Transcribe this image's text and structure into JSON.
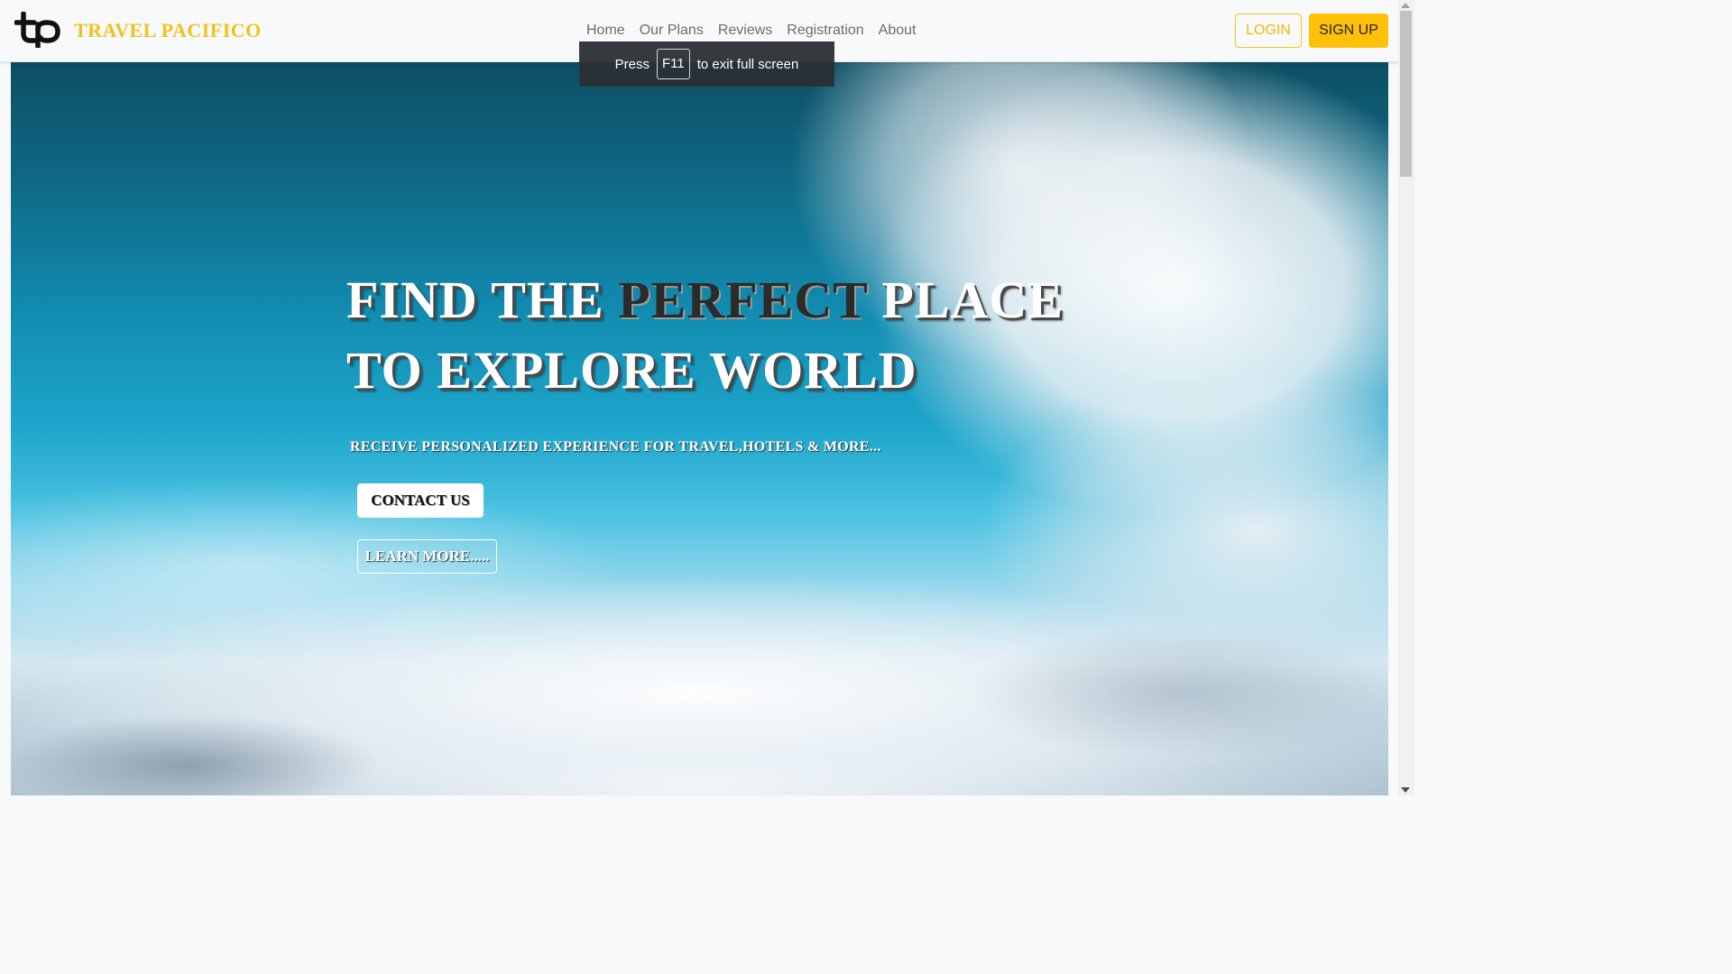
{
  "navbar": {
    "brand": {
      "logo_icon": "tp-monogram-logo",
      "name": "TRAVEL PACIFICO"
    },
    "links": [
      "Home",
      "Our Plans",
      "Reviews",
      "Registration",
      "About"
    ],
    "login_label": "LOGIN",
    "signup_label": "SIGN UP"
  },
  "fullscreen_notice": {
    "before": "Press",
    "key": "F11",
    "after": "to exit full screen"
  },
  "hero": {
    "title_line1_start": "FIND THE ",
    "title_line1_highlight": "PERFECT",
    "title_line1_end": " PLACE",
    "title_line2": "TO EXPLORE WORLD",
    "subtitle": "RECEIVE PERSONALIZED EXPERIENCE FOR TRAVEL,HOTELS & MORE...",
    "contact_label": "CONTACT US",
    "learn_more_label": "LEARN MORE....."
  },
  "colors": {
    "brand_yellow": "#ffc107",
    "brand_text": "#f2c21a",
    "navbar_bg": "#f8f9fa",
    "sky_top": "#0d4f63",
    "sky_mid": "#1ea6cc"
  }
}
